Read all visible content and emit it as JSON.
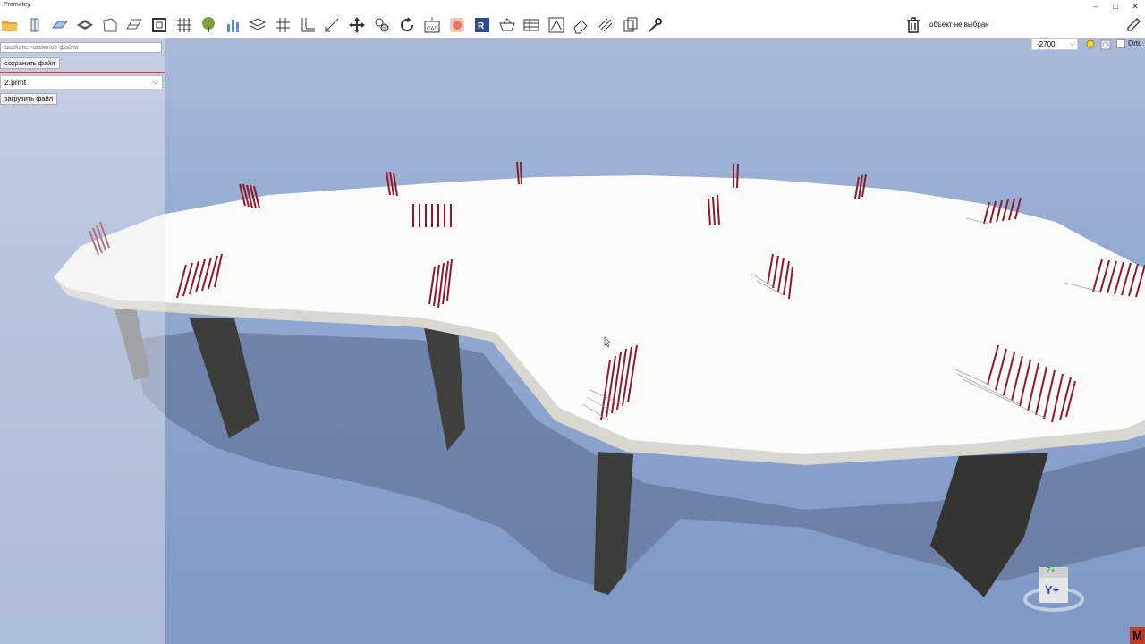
{
  "window": {
    "title": "Prometey",
    "minimize": "–",
    "maximize": "□",
    "close": "✕"
  },
  "toolbar": {
    "icons": [
      "folder-open-icon",
      "column-icon",
      "slab-icon",
      "beam-icon",
      "wall-icon",
      "floor-plate-icon",
      "frame-icon",
      "grid-icon",
      "tree-icon",
      "chart-icon",
      "layers-icon",
      "axis-grid-icon",
      "curve-icon",
      "dimension-icon",
      "move-icon",
      "node-icon",
      "rotate-icon",
      "cad-import-icon",
      "ifc-import-icon",
      "revit-import-icon",
      "basket-icon",
      "table-icon",
      "drawing-icon",
      "eraser-icon",
      "rebar-icon",
      "copy-icon",
      "wrench-icon"
    ],
    "status_text": "объект не выбран",
    "trash_icon": "trash-icon",
    "pencil_icon": "pencil-icon"
  },
  "left_panel": {
    "filename_placeholder": "введите название файла",
    "save_button": "сохранить файл",
    "file_selected": "2.prmt",
    "load_button": "загрузить файл"
  },
  "view_controls": {
    "level": "-2700",
    "light_icon": "bulb-icon",
    "render_icon": "render-icon",
    "orto_label": "Orto"
  },
  "nav_cube": {
    "top_label": "Z+",
    "front_label": "Y+"
  },
  "corner_badge": "M",
  "colors": {
    "sky": "#8fa5cc",
    "slab": "#fafafa",
    "column": "#3d3d3b",
    "rebar": "#8b1a2a",
    "toolbar_bg": "#ffffff"
  }
}
